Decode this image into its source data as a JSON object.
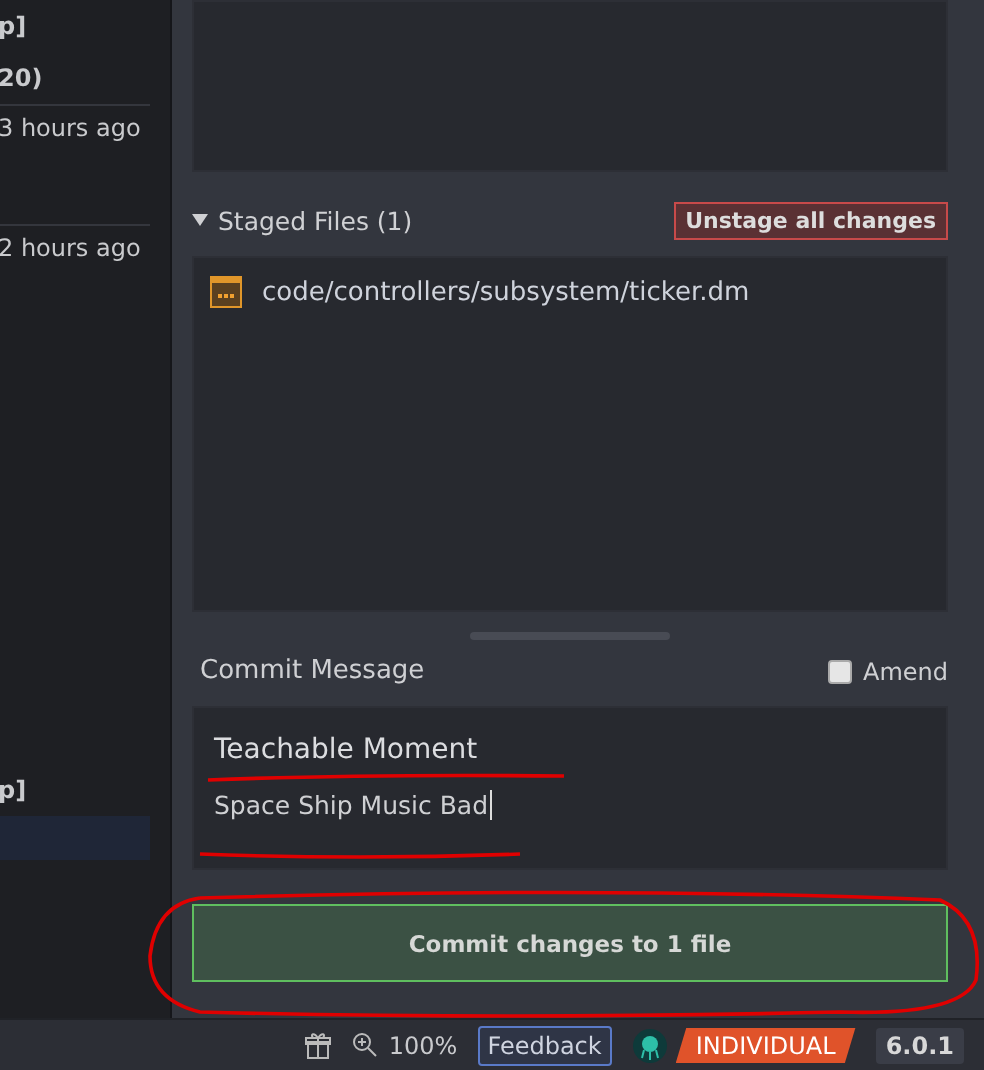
{
  "history": [
    {
      "kind": "title",
      "text": "p]",
      "selected": false
    },
    {
      "kind": "title",
      "text": "20)",
      "selected": false
    },
    {
      "kind": "time",
      "text": "3 hours ago",
      "selected": false
    },
    {
      "kind": "time",
      "text": "2 hours ago",
      "selected": false
    },
    {
      "kind": "title",
      "text": "p]",
      "selected": false
    },
    {
      "kind": "blank",
      "selected": true
    }
  ],
  "staged": {
    "title": "Staged Files (1)",
    "expanded": true,
    "unstage_button": "Unstage all changes",
    "files": [
      "code/controllers/subsystem/ticker.dm"
    ]
  },
  "commit": {
    "label": "Commit Message",
    "amend": {
      "label": "Amend",
      "checked": false
    },
    "summary": "Teachable Moment",
    "description": "Space Ship Music Bad",
    "button": "Commit changes to 1 file"
  },
  "status_bar": {
    "zoom": "100%",
    "feedback": "Feedback",
    "license": "INDIVIDUAL",
    "version": "6.0.1"
  }
}
